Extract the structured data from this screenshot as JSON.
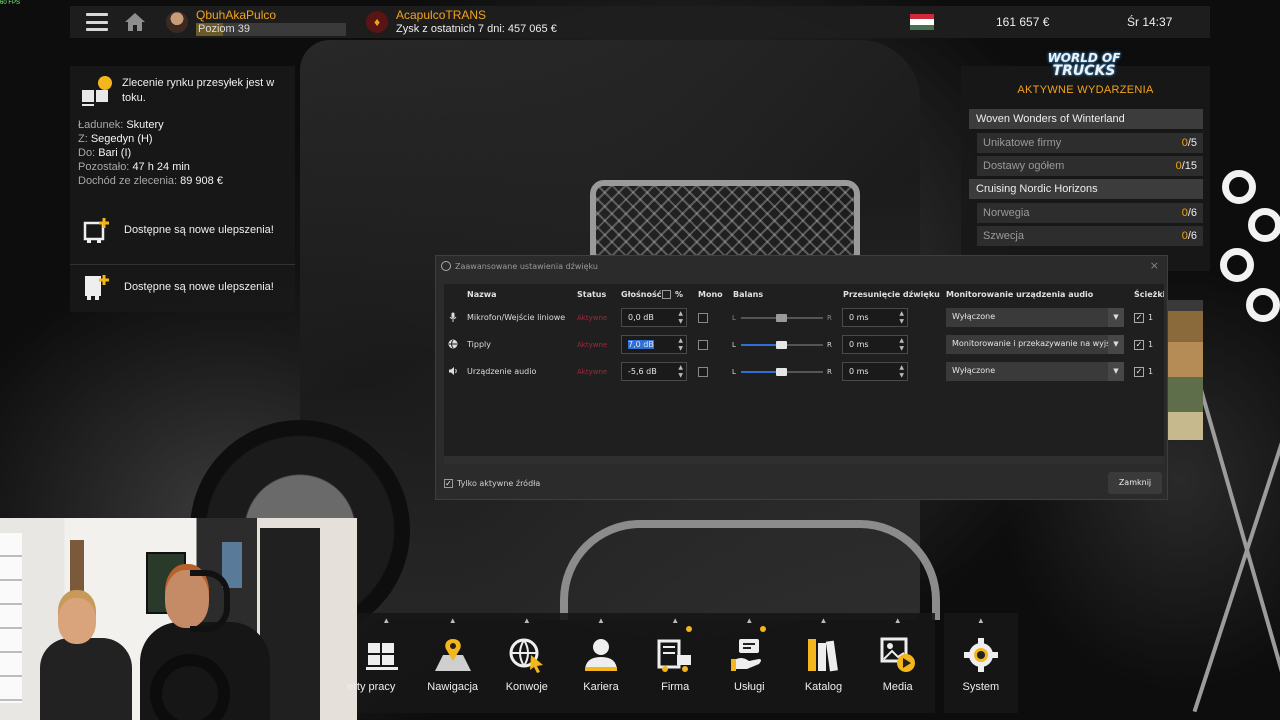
{
  "overlay": {
    "fps": "60 FPS"
  },
  "topbar": {
    "player_name": "QbuhAkaPulco",
    "player_level": "Poziom 39",
    "company_name": "AcapulcoTRANS",
    "company_profit": "Zysk z ostatnich 7 dni: 457 065 €",
    "money": "161 657 €",
    "clock": "Śr 14:37"
  },
  "job": {
    "title": "Zlecenie rynku przesyłek jest w toku.",
    "cargo_label": "Ładunek:",
    "cargo_value": "Skutery",
    "from_label": "Z:",
    "from_value": "Segedyn (H)",
    "to_label": "Do:",
    "to_value": "Bari (I)",
    "remaining_label": "Pozostało:",
    "remaining_value": "47 h 24 min",
    "income_label": "Dochód ze zlecenia:",
    "income_value": "89 908 €"
  },
  "upgrades": [
    {
      "label": "Dostępne są nowe ulepszenia!"
    },
    {
      "label": "Dostępne są nowe ulepszenia!"
    }
  ],
  "events": {
    "logo_line1": "WORLD OF",
    "logo_line2": "TRUCKS",
    "heading": "AKTYWNE WYDARZENIA",
    "groups": [
      {
        "title": "Woven Wonders of Winterland",
        "rows": [
          {
            "label": "Unikatowe firmy",
            "done": "0",
            "total": "/5"
          },
          {
            "label": "Dostawy ogółem",
            "done": "0",
            "total": "/15"
          }
        ]
      },
      {
        "title": "Cruising Nordic Horizons",
        "rows": [
          {
            "label": "Norwegia",
            "done": "0",
            "total": "/6"
          },
          {
            "label": "Szwecja",
            "done": "0",
            "total": "/6"
          }
        ]
      }
    ]
  },
  "audio_dialog": {
    "title": "Zaawansowane ustawienia dźwięku",
    "close_x": "×",
    "headers": {
      "name": "Nazwa",
      "status": "Status",
      "volume": "Głośność",
      "percent": "%",
      "mono": "Mono",
      "balance": "Balans",
      "sync": "Przesunięcie dźwięku",
      "monitoring": "Monitorowanie urządzenia audio",
      "tracks": "Ścieżki"
    },
    "balance_left": "L",
    "balance_right": "R",
    "sources": [
      {
        "icon": "microphone-icon",
        "name": "Mikrofon/Wejście liniowe",
        "status": "Aktywne",
        "volume": "0,0 dB",
        "mono": false,
        "balance": 0.5,
        "balance_enabled": false,
        "sync": "0 ms",
        "monitoring": "Wyłączone",
        "track": "1"
      },
      {
        "icon": "browser-source-icon",
        "name": "Tipply",
        "status": "Aktywne",
        "volume": "7,0 dB",
        "mono": false,
        "balance": 0.5,
        "balance_enabled": true,
        "sync": "0 ms",
        "monitoring": "Monitorowanie i przekazywanie na wyjście",
        "track": "1"
      },
      {
        "icon": "speaker-icon",
        "name": "Urządzenie audio",
        "status": "Aktywne",
        "volume": "-5,6 dB",
        "mono": false,
        "balance": 0.5,
        "balance_enabled": true,
        "sync": "0 ms",
        "monitoring": "Wyłączone",
        "track": "1"
      }
    ],
    "active_only_label": "Tylko aktywne źródła",
    "active_only_checked": true,
    "close_button": "Zamknij"
  },
  "bottom_menu": [
    {
      "label": "Oferty pracy",
      "visible_label": "erty pracy",
      "icon": "cargo-icon",
      "notif": false
    },
    {
      "label": "Nawigacja",
      "icon": "map-pin-icon",
      "notif": false
    },
    {
      "label": "Konwoje",
      "icon": "globe-cursor-icon",
      "notif": false
    },
    {
      "label": "Kariera",
      "icon": "person-icon",
      "notif": false
    },
    {
      "label": "Firma",
      "icon": "truck-board-icon",
      "notif": true
    },
    {
      "label": "Usługi",
      "icon": "hand-service-icon",
      "notif": true
    },
    {
      "label": "Katalog",
      "icon": "books-icon",
      "notif": false
    },
    {
      "label": "Media",
      "icon": "media-icon",
      "notif": false
    },
    {
      "label": "System",
      "icon": "gear-icon",
      "notif": false
    }
  ],
  "colors": {
    "accent": "#f3a31b",
    "status_active": "#a0283a",
    "balance_blue": "#2f6fd6"
  }
}
